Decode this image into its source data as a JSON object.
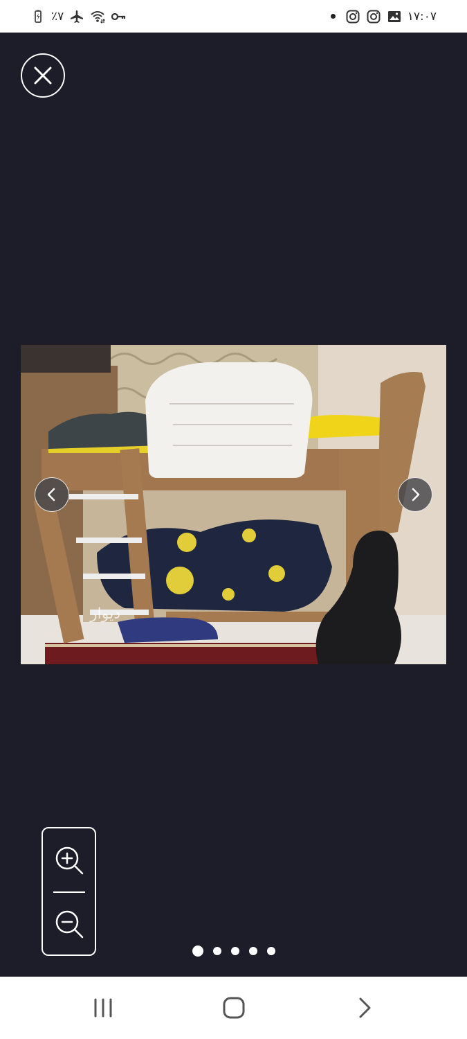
{
  "status_bar": {
    "battery_text": "٪۷",
    "time": "۱۷:۰۷",
    "left_icons": [
      "battery-charging-icon",
      "airplane-icon",
      "wifi-icon",
      "vpn-key-icon"
    ],
    "right_icons": [
      "notification-dot-icon",
      "instagram-icon",
      "instagram-icon",
      "gallery-icon"
    ]
  },
  "viewer": {
    "close_icon": "close-icon",
    "photo_watermark": "دیوار",
    "prev_icon": "chevron-left-icon",
    "next_icon": "chevron-right-icon",
    "zoom_in_icon": "zoom-in-icon",
    "zoom_out_icon": "zoom-out-icon",
    "pager": {
      "count": 5,
      "active_index": 0
    }
  },
  "system_nav": {
    "recent_icon": "recent-apps-icon",
    "home_icon": "home-icon",
    "back_icon": "back-chevron-icon"
  },
  "colors": {
    "background": "#1d1d2a",
    "status_bar": "#ffffff",
    "nav_bar": "#ffffff"
  }
}
